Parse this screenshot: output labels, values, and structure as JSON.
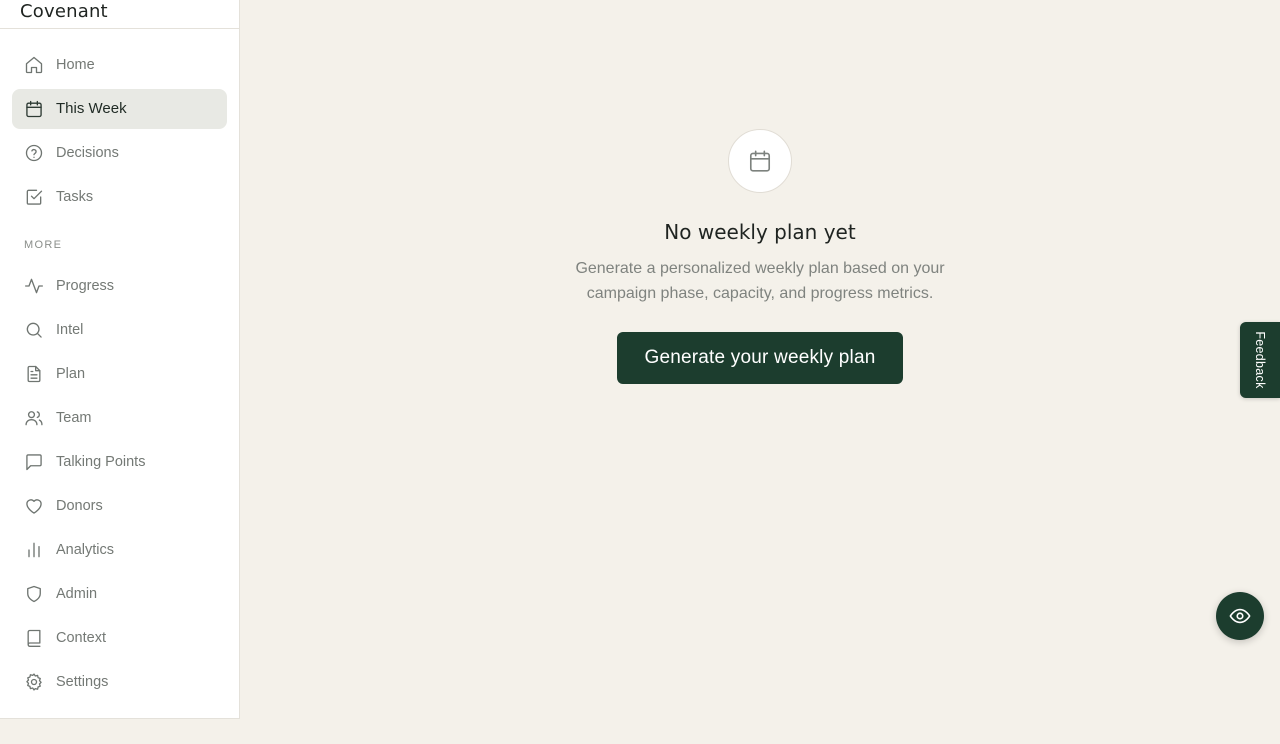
{
  "app": {
    "brand": "Covenant"
  },
  "sidebar": {
    "primary": [
      {
        "label": "Home",
        "icon": "home-icon",
        "active": false
      },
      {
        "label": "This Week",
        "icon": "calendar-icon",
        "active": true
      },
      {
        "label": "Decisions",
        "icon": "help-circle-icon",
        "active": false
      },
      {
        "label": "Tasks",
        "icon": "check-square-icon",
        "active": false
      }
    ],
    "more_label": "MORE",
    "more": [
      {
        "label": "Progress",
        "icon": "activity-icon"
      },
      {
        "label": "Intel",
        "icon": "search-icon"
      },
      {
        "label": "Plan",
        "icon": "file-text-icon"
      },
      {
        "label": "Team",
        "icon": "users-icon"
      },
      {
        "label": "Talking Points",
        "icon": "message-square-icon"
      },
      {
        "label": "Donors",
        "icon": "heart-icon"
      },
      {
        "label": "Analytics",
        "icon": "bar-chart-icon"
      },
      {
        "label": "Admin",
        "icon": "shield-icon"
      },
      {
        "label": "Context",
        "icon": "book-icon"
      },
      {
        "label": "Settings",
        "icon": "gear-icon"
      }
    ]
  },
  "main": {
    "empty_state": {
      "icon": "calendar-icon",
      "title": "No weekly plan yet",
      "description": "Generate a personalized weekly plan based on your campaign phase, capacity, and progress metrics.",
      "cta_label": "Generate your weekly plan"
    }
  },
  "feedback": {
    "label": "Feedback"
  },
  "fab": {
    "icon": "eye-icon"
  },
  "colors": {
    "accent": "#1c3d2e",
    "background": "#f4f1ea",
    "sidebar_bg": "#ffffff",
    "active_item_bg": "#e8e9e4"
  }
}
